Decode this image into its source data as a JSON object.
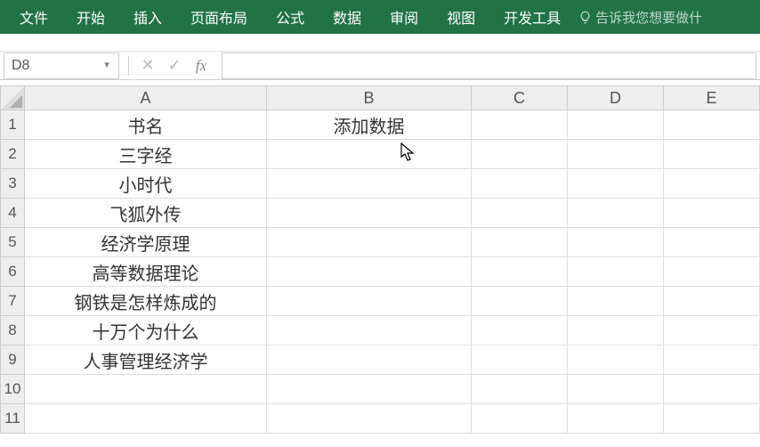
{
  "ribbon": {
    "tabs": [
      "文件",
      "开始",
      "插入",
      "页面布局",
      "公式",
      "数据",
      "审阅",
      "视图",
      "开发工具"
    ],
    "tell_me": "告诉我您想要做什"
  },
  "formula_bar": {
    "name_box": "D8",
    "cancel": "✕",
    "confirm": "✓",
    "fx": "fx",
    "value": ""
  },
  "columns": [
    "A",
    "B",
    "C",
    "D",
    "E"
  ],
  "rows": [
    "1",
    "2",
    "3",
    "4",
    "5",
    "6",
    "7",
    "8",
    "9",
    "10",
    "11"
  ],
  "chart_data": {
    "type": "table",
    "columns": [
      "A",
      "B"
    ],
    "data": [
      [
        "书名",
        "添加数据"
      ],
      [
        "三字经",
        ""
      ],
      [
        "小时代",
        ""
      ],
      [
        "飞狐外传",
        ""
      ],
      [
        "经济学原理",
        ""
      ],
      [
        "高等数据理论",
        ""
      ],
      [
        "钢铁是怎样炼成的",
        ""
      ],
      [
        "十万个为什么",
        ""
      ],
      [
        "人事管理经济学",
        ""
      ],
      [
        "",
        ""
      ],
      [
        "",
        ""
      ]
    ]
  }
}
